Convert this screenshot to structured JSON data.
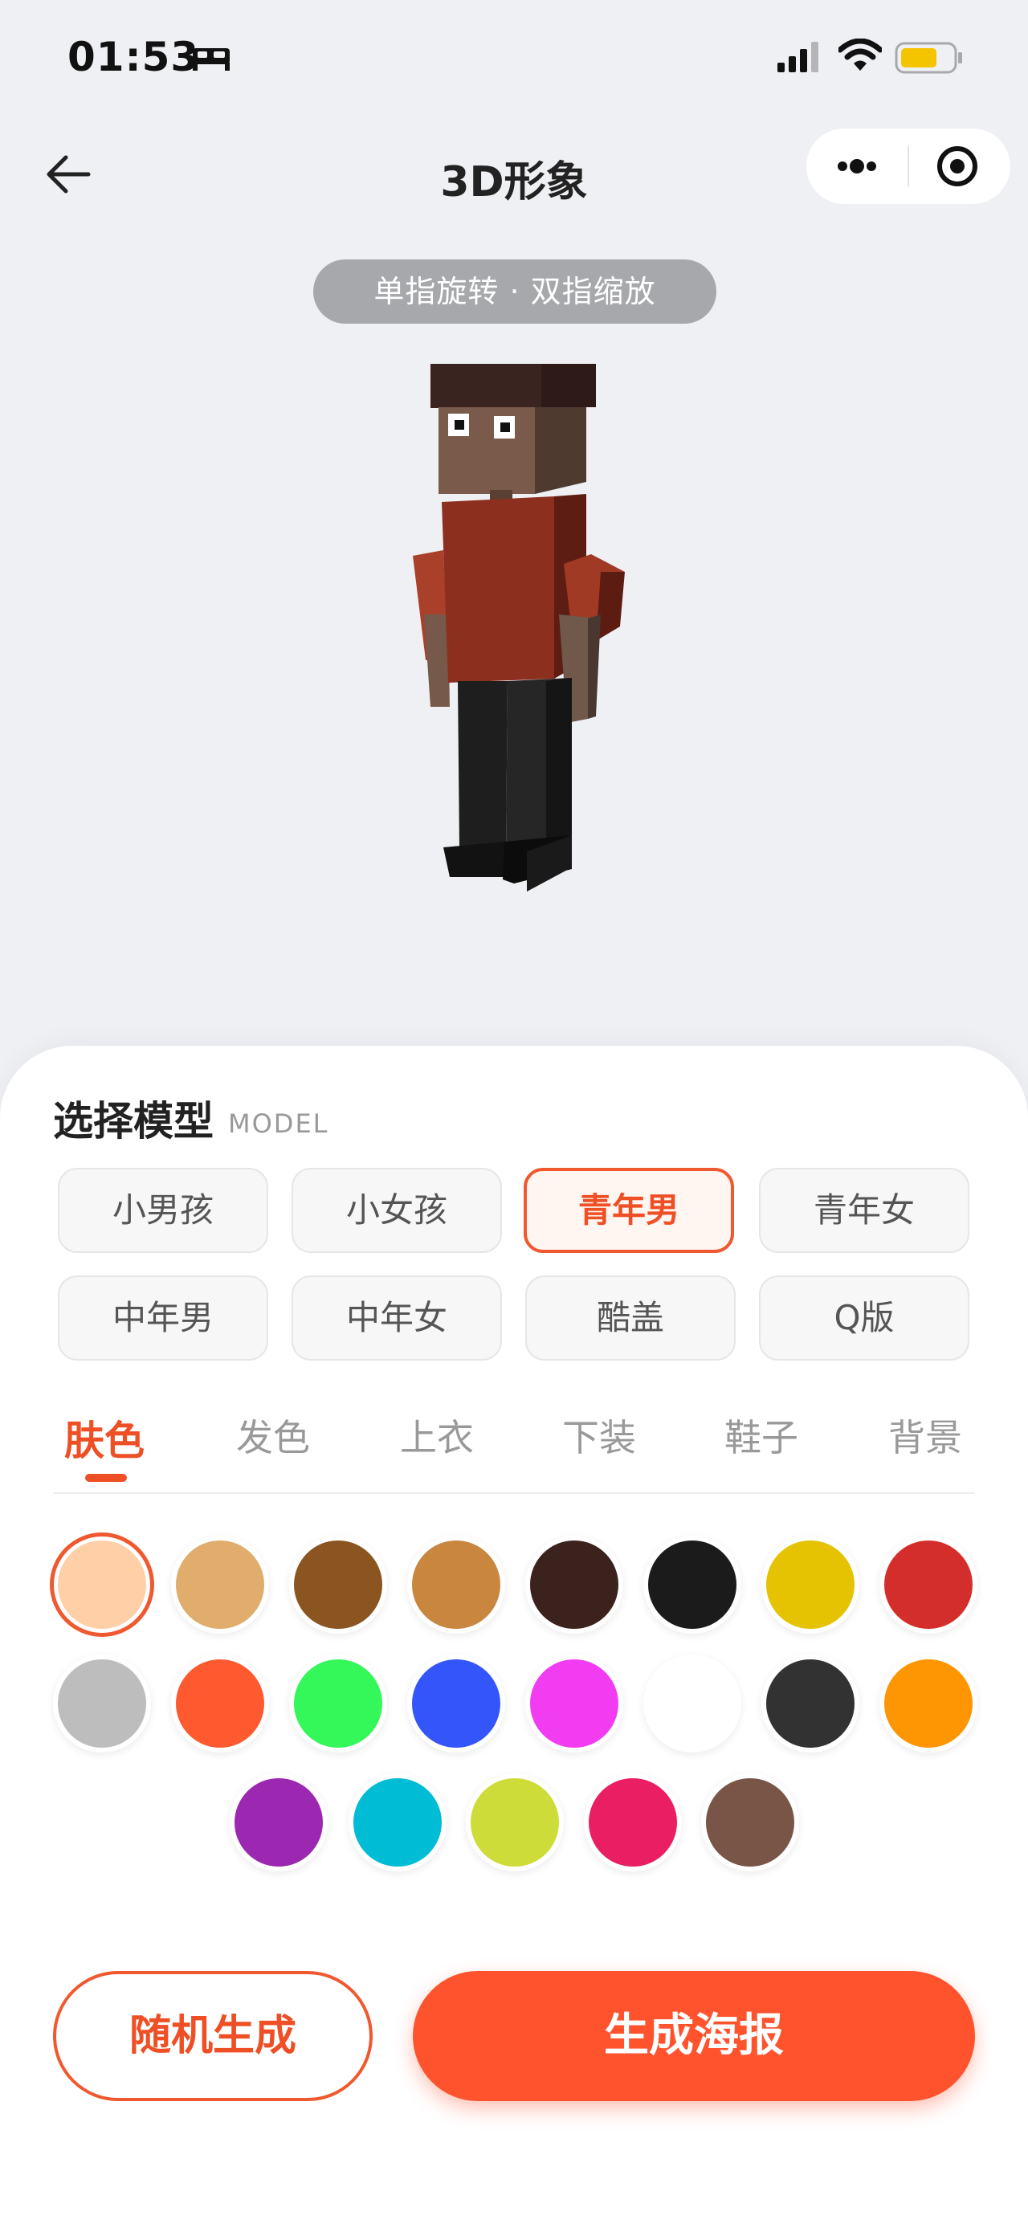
{
  "status_bar": {
    "time": "01:53",
    "icons": [
      "bed-icon",
      "signal-icon",
      "wifi-icon",
      "battery-icon"
    ],
    "battery_color": "#f5c400"
  },
  "nav": {
    "title": "3D形象",
    "icons": [
      "back-arrow-icon",
      "more-dots-icon",
      "target-icon"
    ]
  },
  "hint": "单指旋转 · 双指缩放",
  "avatar_colors": {
    "hair": "#2e1b17",
    "skin": "#7a5a4b",
    "shirt": "#8c2f1e",
    "pants": "#1e1e1e",
    "shoes": "#111111"
  },
  "model_section": {
    "title": "选择模型",
    "subtitle": "MODEL",
    "models": [
      {
        "label": "小男孩",
        "active": false
      },
      {
        "label": "小女孩",
        "active": false
      },
      {
        "label": "青年男",
        "active": true
      },
      {
        "label": "青年女",
        "active": false
      },
      {
        "label": "中年男",
        "active": false
      },
      {
        "label": "中年女",
        "active": false
      },
      {
        "label": "酷盖",
        "active": false
      },
      {
        "label": "Q版",
        "active": false
      }
    ]
  },
  "tabs": [
    {
      "label": "肤色",
      "active": true
    },
    {
      "label": "发色",
      "active": false
    },
    {
      "label": "上衣",
      "active": false
    },
    {
      "label": "下装",
      "active": false
    },
    {
      "label": "鞋子",
      "active": false
    },
    {
      "label": "背景",
      "active": false
    }
  ],
  "swatches": [
    {
      "color": "#ffcfa8",
      "selected": true
    },
    {
      "color": "#e0ad6c",
      "selected": false
    },
    {
      "color": "#8b5522",
      "selected": false
    },
    {
      "color": "#c8863e",
      "selected": false
    },
    {
      "color": "#3c221d",
      "selected": false
    },
    {
      "color": "#1b1b1b",
      "selected": false
    },
    {
      "color": "#e6c302",
      "selected": false
    },
    {
      "color": "#d42e2c",
      "selected": false
    },
    {
      "color": "#bdbdbd",
      "selected": false
    },
    {
      "color": "#ff5a2f",
      "selected": false
    },
    {
      "color": "#34f75a",
      "selected": false
    },
    {
      "color": "#3455fa",
      "selected": false
    },
    {
      "color": "#f23cf2",
      "selected": false
    },
    {
      "color": "#ffffff",
      "selected": false
    },
    {
      "color": "#323232",
      "selected": false
    },
    {
      "color": "#fe9502",
      "selected": false
    },
    {
      "color": "#9c27b0",
      "selected": false
    },
    {
      "color": "#00bcd4",
      "selected": false
    },
    {
      "color": "#cddc39",
      "selected": false
    },
    {
      "color": "#e91e63",
      "selected": false
    },
    {
      "color": "#795548",
      "selected": false
    }
  ],
  "actions": {
    "random_label": "随机生成",
    "generate_label": "生成海报"
  }
}
